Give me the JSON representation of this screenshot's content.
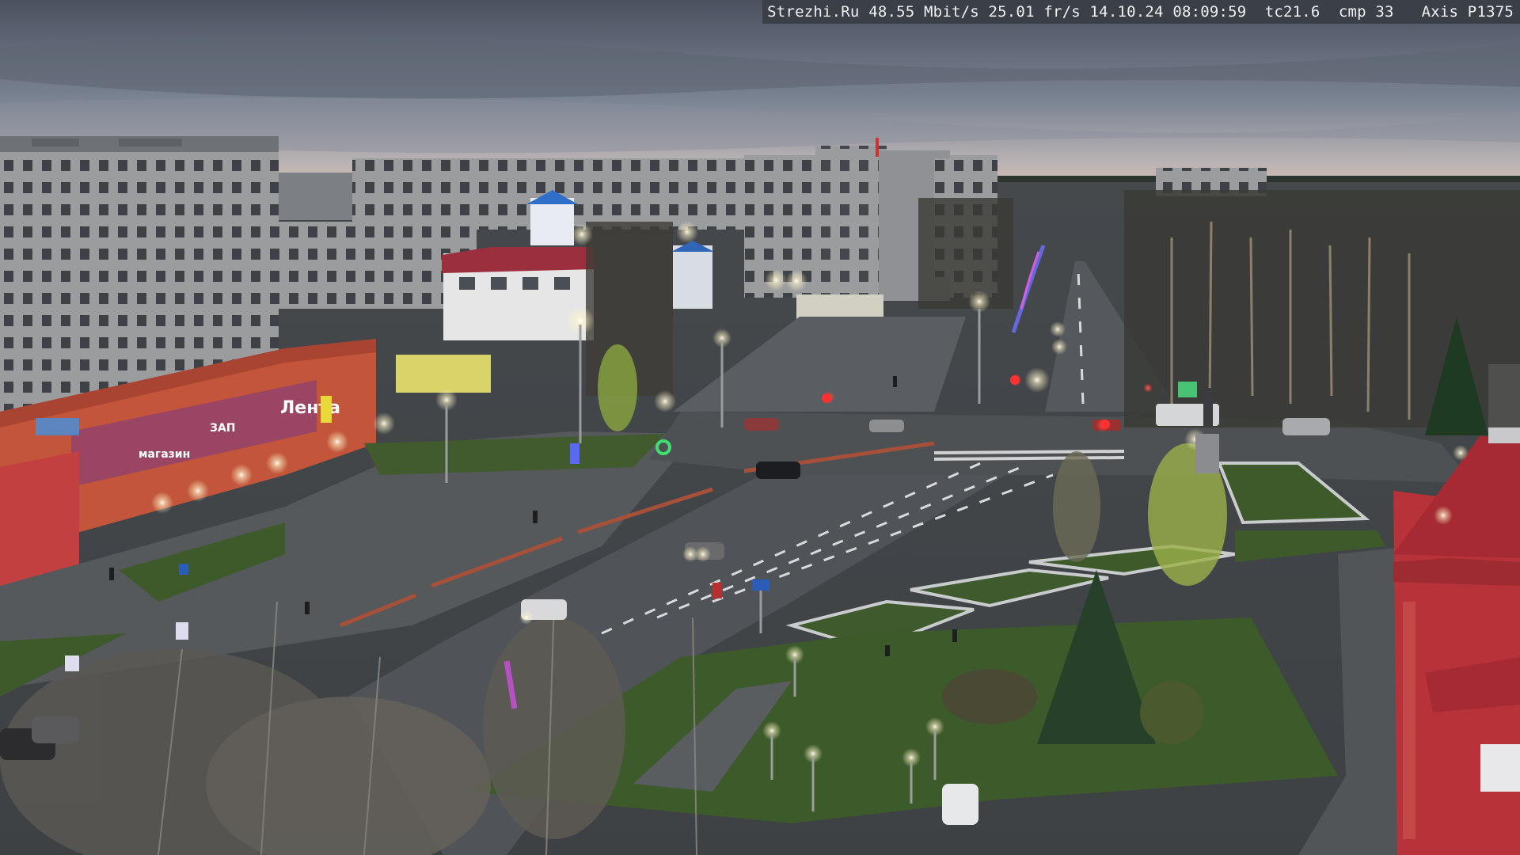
{
  "overlay": {
    "site": "Strezhi.Ru",
    "bitrate": "48.55 Mbit/s",
    "framerate": "25.01 fr/s",
    "date": "14.10.24",
    "time": "08:09:59",
    "tc": "tc21.6",
    "cmp": "cmp 33",
    "camera": "Axis P1375"
  },
  "signs": {
    "mall": "Лента",
    "shop_left": "магазин",
    "shop_mid": "ЗАП"
  },
  "palette": {
    "sky_top": "#4b5360",
    "sky_horizon": "#c9b8b0",
    "road": "#505458",
    "grass": "#3c5a2a",
    "lamp": "#fff7d8",
    "building": "#8d8f92",
    "mall_wall": "#c2553a",
    "tower_red": "#b8323a"
  }
}
